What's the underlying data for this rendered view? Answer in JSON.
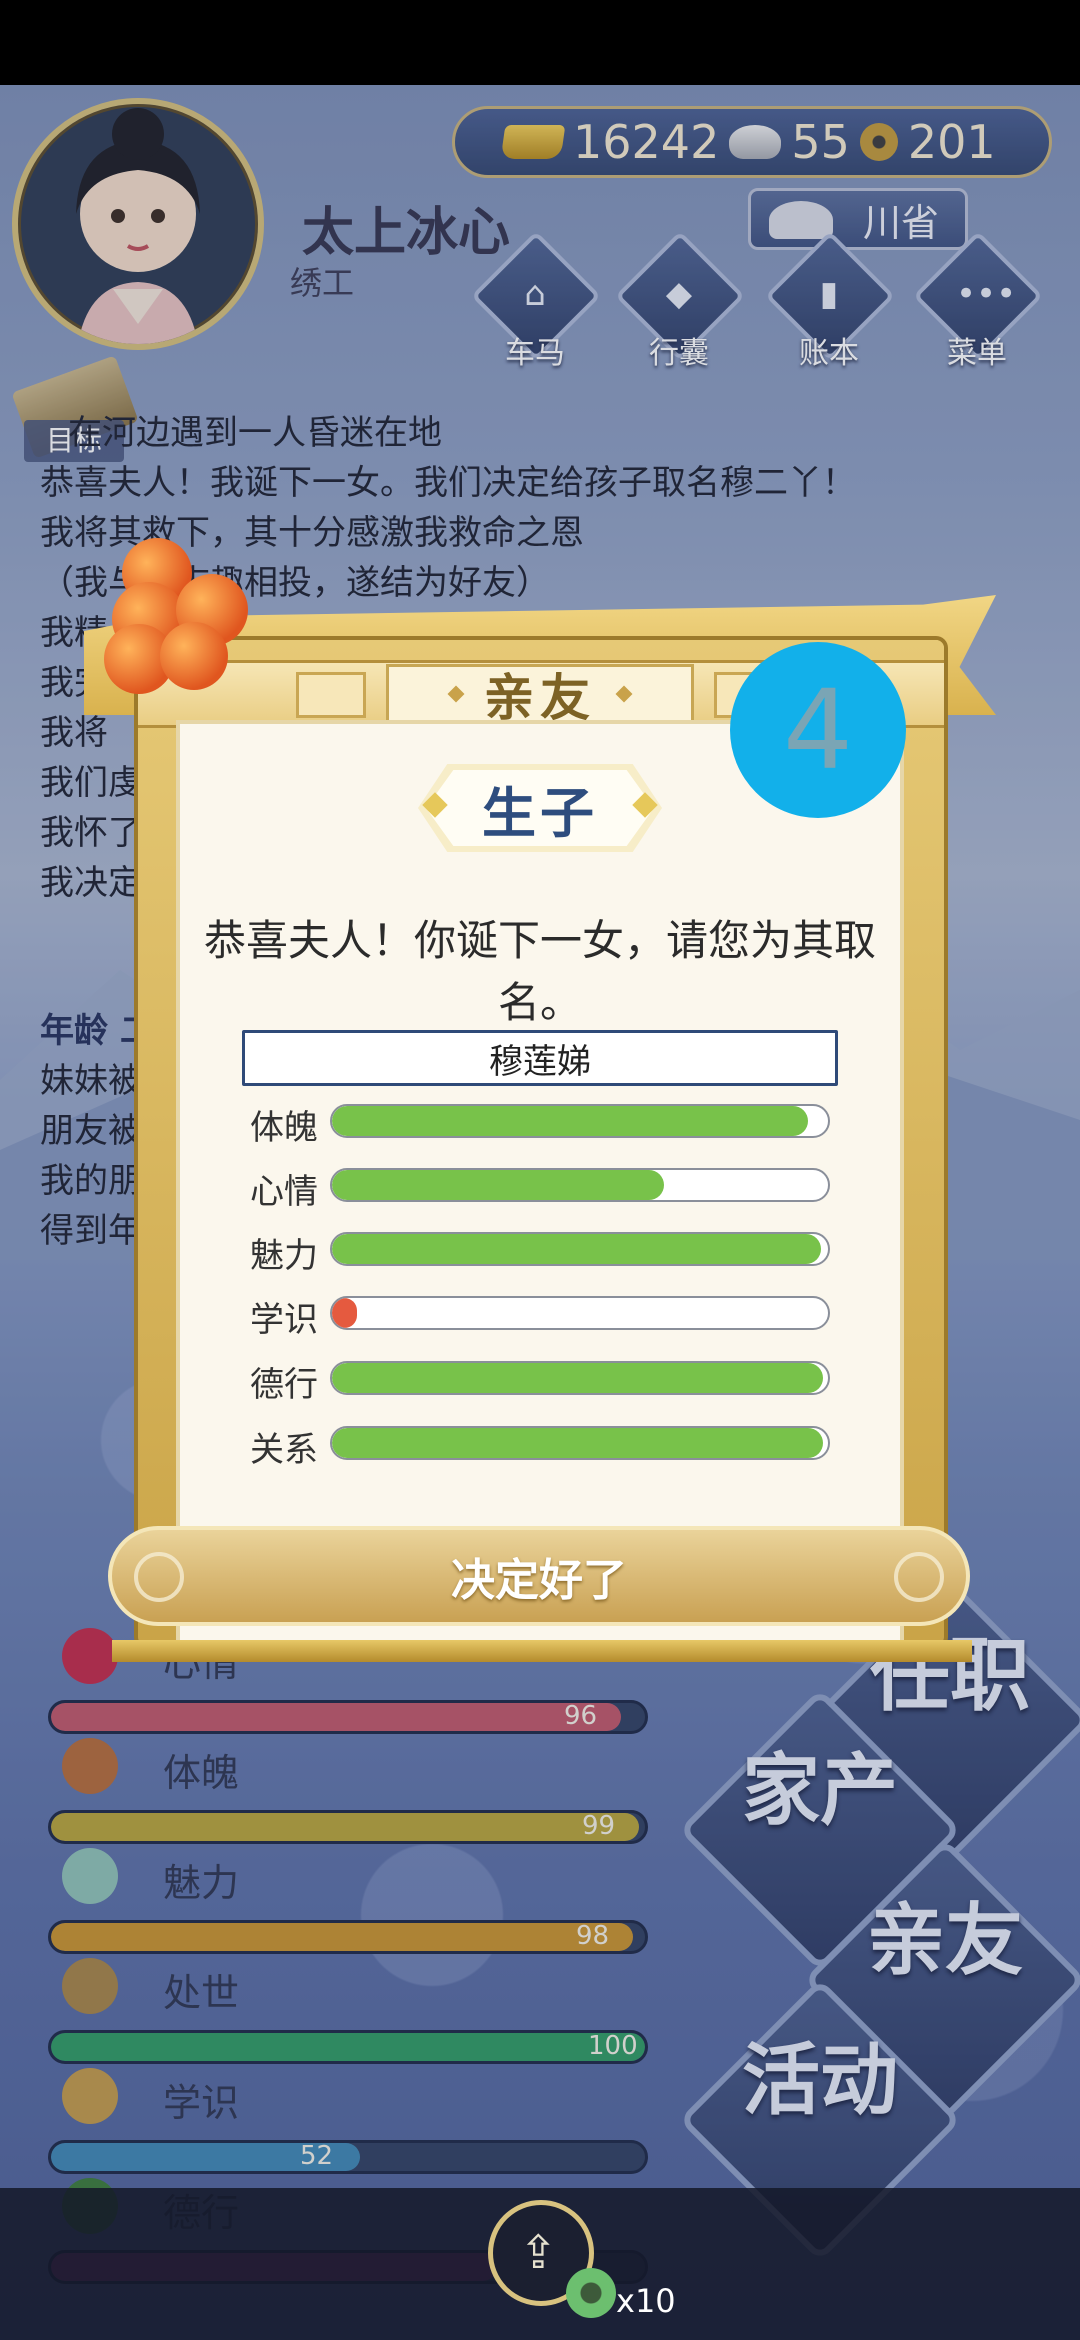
{
  "hud": {
    "gold": "16242",
    "silver": "55",
    "coins": "201",
    "player_name": "太上冰心",
    "player_title": "绣工",
    "location": "川省",
    "buttons": [
      "车马",
      "行囊",
      "账本",
      "菜单"
    ]
  },
  "log": {
    "goal_label": "目标",
    "lines": [
      "在河边遇到一人昏迷在地",
      "恭喜夫人！我诞下一女。我们决定给孩子取名穆二丫！",
      "我将其救下，其十分感激我救命之恩",
      "（我与其志趣相投，遂结为好友）",
      "我精",
      "我完",
      "我将",
      "我们虔",
      "我怀了",
      "我决定"
    ],
    "age_label": "年龄 二",
    "lines2": [
      "妹妹被",
      "朋友被",
      "我的朋",
      "得到年"
    ]
  },
  "stats": [
    {
      "name": "心情",
      "value": "96",
      "pct": 0.96,
      "color": "#c0576a"
    },
    {
      "name": "体魄",
      "value": "99",
      "pct": 0.99,
      "color": "#b7a43a"
    },
    {
      "name": "魅力",
      "value": "98",
      "pct": 0.98,
      "color": "#c9932e"
    },
    {
      "name": "处世",
      "value": "100",
      "pct": 1.0,
      "color": "#2f9a63"
    },
    {
      "name": "学识",
      "value": "52",
      "pct": 0.52,
      "color": "#3f87b4"
    },
    {
      "name": "德行",
      "value": "",
      "pct": 0.75,
      "color": "#8a3b82"
    }
  ],
  "right_menu": [
    "任职",
    "家产",
    "亲友",
    "活动"
  ],
  "dialog": {
    "header": "亲友",
    "section": "生子",
    "message": "恭喜夫人！你诞下一女，请您为其取名。",
    "name_value": "穆莲娣",
    "attributes": [
      {
        "label": "体魄",
        "pct": 0.96,
        "color": "#78c24a"
      },
      {
        "label": "心情",
        "pct": 0.67,
        "color": "#78c24a"
      },
      {
        "label": "魅力",
        "pct": 0.985,
        "color": "#78c24a"
      },
      {
        "label": "学识",
        "pct": 0.05,
        "color": "#e55a3f"
      },
      {
        "label": "德行",
        "pct": 0.99,
        "color": "#78c24a"
      },
      {
        "label": "关系",
        "pct": 0.99,
        "color": "#78c24a"
      }
    ],
    "confirm": "决定好了",
    "step": "4"
  },
  "bottom": {
    "coin_count": "x10"
  },
  "colors": {
    "accent_gold": "#d9b24e",
    "step_badge": "#12b0ea",
    "bar_green": "#78c24a",
    "bar_red": "#e55a3f"
  }
}
